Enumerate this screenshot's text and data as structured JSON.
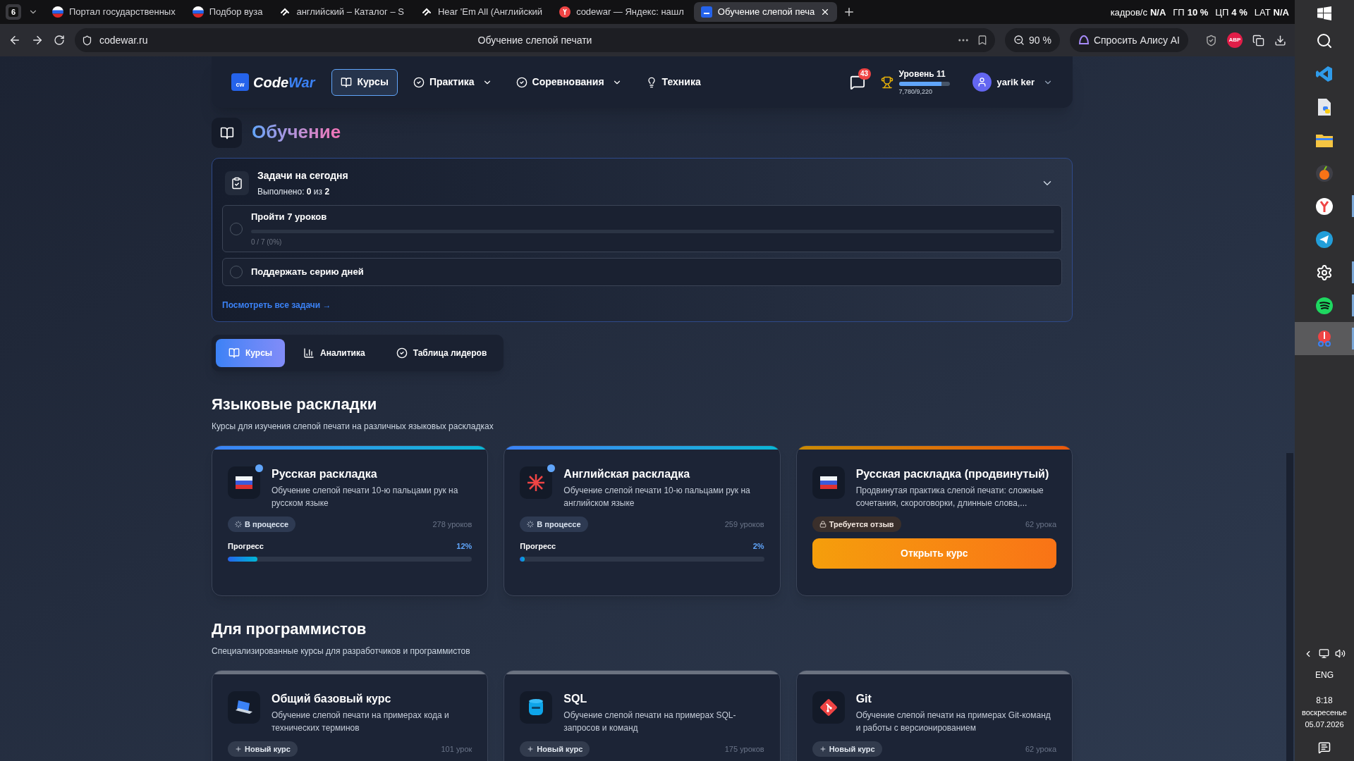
{
  "browser": {
    "tab_counter": "6",
    "tabs": [
      {
        "title": "Портал государственных",
        "kind": "flag",
        "selected": false
      },
      {
        "title": "Подбор вуза",
        "kind": "flag",
        "selected": false
      },
      {
        "title": "английский – Каталог – S",
        "kind": "skill",
        "selected": false
      },
      {
        "title": "Hear 'Em All (Английский",
        "kind": "skill",
        "selected": false
      },
      {
        "title": "codewar — Яндекс: нашл",
        "kind": "yandex",
        "selected": false
      },
      {
        "title": "Обучение слепой печа",
        "kind": "cw",
        "selected": true
      }
    ],
    "address": "codewar.ru",
    "page_title": "Обучение слепой печати",
    "zoom": "90 %",
    "alice_button": "Спросить Алису AI",
    "adblock_badge": "ABP"
  },
  "overlay": {
    "fps_label": "кадров/с",
    "fps_value": "N/A",
    "gpu_label": "ГП",
    "gpu_value": "10 %",
    "cpu_label": "ЦП",
    "cpu_value": "4 %",
    "lat_label": "LAT",
    "lat_value": "N/A"
  },
  "site": {
    "logo": {
      "mark": "cw",
      "name_a": "Code",
      "name_b": "War"
    },
    "nav": [
      {
        "label": "Курсы",
        "kind": "book",
        "dropdown": false,
        "selected": true
      },
      {
        "label": "Практика",
        "kind": "check",
        "dropdown": true,
        "selected": false
      },
      {
        "label": "Соревнования",
        "kind": "check",
        "dropdown": true,
        "selected": false
      },
      {
        "label": "Техника",
        "kind": "bulb",
        "dropdown": false,
        "selected": false
      }
    ],
    "notifications": "43",
    "rank": {
      "title": "Уровень 11",
      "level": 0.844,
      "xp": "7,780/9,220"
    },
    "user": "yarik ker"
  },
  "page_title": "Обучение",
  "daily": {
    "title": "Задачи на сегодня",
    "summary": "Выполнено: **0** из **2**",
    "expanded": true,
    "tasks": [
      {
        "title": "Пройти 7 уроков",
        "done": false,
        "level": 0,
        "progress_text": "0 / 7 (0%)"
      },
      {
        "title": "Поддержать серию дней",
        "done": false
      }
    ],
    "link": "Посмотреть все задачи →"
  },
  "tabs": [
    {
      "label": "Курсы",
      "kind": "book",
      "selected": true
    },
    {
      "label": "Аналитика",
      "kind": "chart",
      "selected": false
    },
    {
      "label": "Таблица лидеров",
      "kind": "check",
      "selected": false
    }
  ],
  "sections": [
    {
      "title": "Языковые раскладки",
      "subtitle": "Курсы для изучения слепой печати на различных языковых раскладках",
      "courses": [
        {
          "title": "Русская раскладка",
          "description": "Обучение слепой печати 10-ю пальцами рук на русском языке",
          "kind": "ru",
          "indicator": true,
          "status": {
            "kind": "in_progress",
            "text": "В процессе"
          },
          "lessons": "278 уроков",
          "progress": {
            "label": "Прогресс",
            "value": "12%",
            "level": 0.12
          }
        },
        {
          "title": "Английская раскладка",
          "description": "Обучение слепой печати 10-ю пальцами рук на английском языке",
          "kind": "uk",
          "indicator": true,
          "status": {
            "kind": "in_progress",
            "text": "В процессе"
          },
          "lessons": "259 уроков",
          "progress": {
            "label": "Прогресс",
            "value": "2%",
            "level": 0.02
          }
        },
        {
          "title": "Русская раскладка (продвинутый)",
          "description": "Продвинутая практика слепой печати: сложные сочетания, скороговорки, длинные слова,...",
          "kind": "ru",
          "indicator": false,
          "status": {
            "kind": "review",
            "text": "Требуется отзыв"
          },
          "lessons": "62 урока",
          "button": "Открыть курс"
        }
      ]
    },
    {
      "title": "Для программистов",
      "subtitle": "Специализированные курсы для разработчиков и программистов",
      "courses": [
        {
          "title": "Общий базовый курс",
          "description": "Обучение слепой печати на примерах кода и технических терминов",
          "kind": "laptop",
          "indicator": false,
          "status": {
            "kind": "new",
            "text": "Новый курс"
          },
          "lessons": "101 урок"
        },
        {
          "title": "SQL",
          "description": "Обучение слепой печати на примерах SQL-запросов и команд",
          "kind": "database",
          "indicator": false,
          "status": {
            "kind": "new",
            "text": "Новый курс"
          },
          "lessons": "175 уроков"
        },
        {
          "title": "Git",
          "description": "Обучение слепой печати на примерах Git-команд и работы с версионированием",
          "kind": "git",
          "indicator": false,
          "status": {
            "kind": "new",
            "text": "Новый курс"
          },
          "lessons": "62 урока"
        }
      ]
    }
  ],
  "taskbar": {
    "apps": [
      {
        "kind": "search",
        "running": false,
        "active": false
      },
      {
        "kind": "code",
        "running": false,
        "active": false
      },
      {
        "kind": "script",
        "running": false,
        "active": false
      },
      {
        "kind": "folder",
        "running": false,
        "active": false
      },
      {
        "kind": "fruit",
        "running": false,
        "active": false
      },
      {
        "kind": "yandex",
        "running": true,
        "active": false
      },
      {
        "kind": "telegram",
        "running": false,
        "active": false
      },
      {
        "kind": "gear",
        "running": true,
        "active": false
      },
      {
        "kind": "spotify",
        "running": true,
        "active": false
      },
      {
        "kind": "scissors",
        "running": true,
        "active": true
      }
    ],
    "language": "ENG",
    "time": "8:18",
    "weekday": "воскресенье",
    "date": "05.07.2026"
  }
}
